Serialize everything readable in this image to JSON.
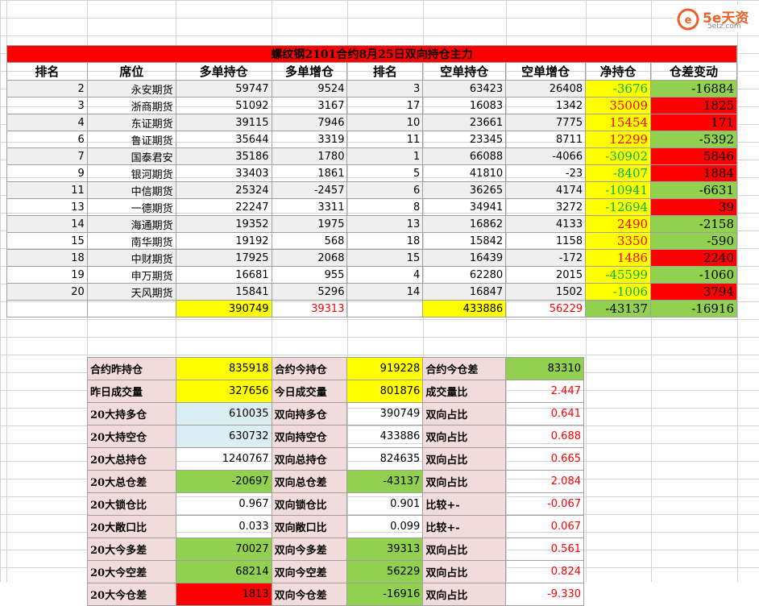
{
  "logo": {
    "brand": "5e天资",
    "url": "5etz.com"
  },
  "title": "螺纹钢2101合约8月25日双向持仓主力",
  "headers": [
    "排名",
    "席位",
    "多单持仓",
    "多单增仓",
    "排名",
    "空单持仓",
    "空单增仓",
    "净持仓",
    "仓差变动"
  ],
  "rows": [
    [
      "2",
      "永安期货",
      "59747",
      "9524",
      "3",
      "63423",
      "26408",
      "-3676",
      "-16884"
    ],
    [
      "3",
      "浙商期货",
      "51092",
      "3167",
      "17",
      "16083",
      "1342",
      "35009",
      "1825"
    ],
    [
      "4",
      "东证期货",
      "39115",
      "7946",
      "10",
      "23661",
      "7775",
      "15454",
      "171"
    ],
    [
      "6",
      "鲁证期货",
      "35644",
      "3319",
      "11",
      "23345",
      "8711",
      "12299",
      "-5392"
    ],
    [
      "7",
      "国泰君安",
      "35186",
      "1780",
      "1",
      "66088",
      "-4066",
      "-30902",
      "5846"
    ],
    [
      "9",
      "银河期货",
      "33403",
      "1861",
      "5",
      "41810",
      "-23",
      "-8407",
      "1884"
    ],
    [
      "11",
      "中信期货",
      "25324",
      "-2457",
      "6",
      "36265",
      "4174",
      "-10941",
      "-6631"
    ],
    [
      "13",
      "一德期货",
      "22247",
      "3311",
      "8",
      "34941",
      "3272",
      "-12694",
      "39"
    ],
    [
      "14",
      "海通期货",
      "19352",
      "1975",
      "13",
      "16862",
      "4133",
      "2490",
      "-2158"
    ],
    [
      "15",
      "南华期货",
      "19192",
      "568",
      "18",
      "15842",
      "1158",
      "3350",
      "-590"
    ],
    [
      "18",
      "中财期货",
      "17925",
      "2068",
      "15",
      "16439",
      "-172",
      "1486",
      "2240"
    ],
    [
      "19",
      "申万期货",
      "16681",
      "955",
      "4",
      "62280",
      "2015",
      "-45599",
      "-1060"
    ],
    [
      "20",
      "天风期货",
      "15841",
      "5296",
      "14",
      "16847",
      "1502",
      "-1006",
      "3794"
    ]
  ],
  "totals": {
    "long": "390749",
    "long_add": "39313",
    "short": "433886",
    "short_add": "56229",
    "net": "-43137",
    "diff": "-16916"
  },
  "summary": [
    [
      "合约昨持仓",
      "835918",
      "合约今持仓",
      "919228",
      "合约今仓差",
      "83310"
    ],
    [
      "昨日成交量",
      "327656",
      "今日成交量",
      "801876",
      "成交量比",
      "2.447"
    ],
    [
      "20大持多仓",
      "610035",
      "双向持多仓",
      "390749",
      "双向占比",
      "0.641"
    ],
    [
      "20大持空仓",
      "630732",
      "双向持空仓",
      "433886",
      "双向占比",
      "0.688"
    ],
    [
      "20大总持仓",
      "1240767",
      "双向总持仓",
      "824635",
      "双向占比",
      "0.665"
    ],
    [
      "20大总仓差",
      "-20697",
      "双向总仓差",
      "-43137",
      "双向占比",
      "2.084"
    ],
    [
      "20大锁仓比",
      "0.967",
      "双向锁仓比",
      "0.901",
      "比较+-",
      "-0.067"
    ],
    [
      "20大敞口比",
      "0.033",
      "双向敞口比",
      "0.099",
      "比较+-",
      "0.067"
    ],
    [
      "20大今多差",
      "70027",
      "双向今多差",
      "39313",
      "双向占比",
      "0.561"
    ],
    [
      "20大今空差",
      "68214",
      "双向今空差",
      "56229",
      "双向占比",
      "0.824"
    ],
    [
      "20大今仓差",
      "1813",
      "双向今仓差",
      "-16916",
      "双向占比",
      "-9.330"
    ]
  ],
  "colors": {
    "red": "#ff0000",
    "yellow": "#ffff00",
    "green": "#92d050",
    "pink": "#f2dcdb",
    "lightblue": "#dbeef3"
  }
}
